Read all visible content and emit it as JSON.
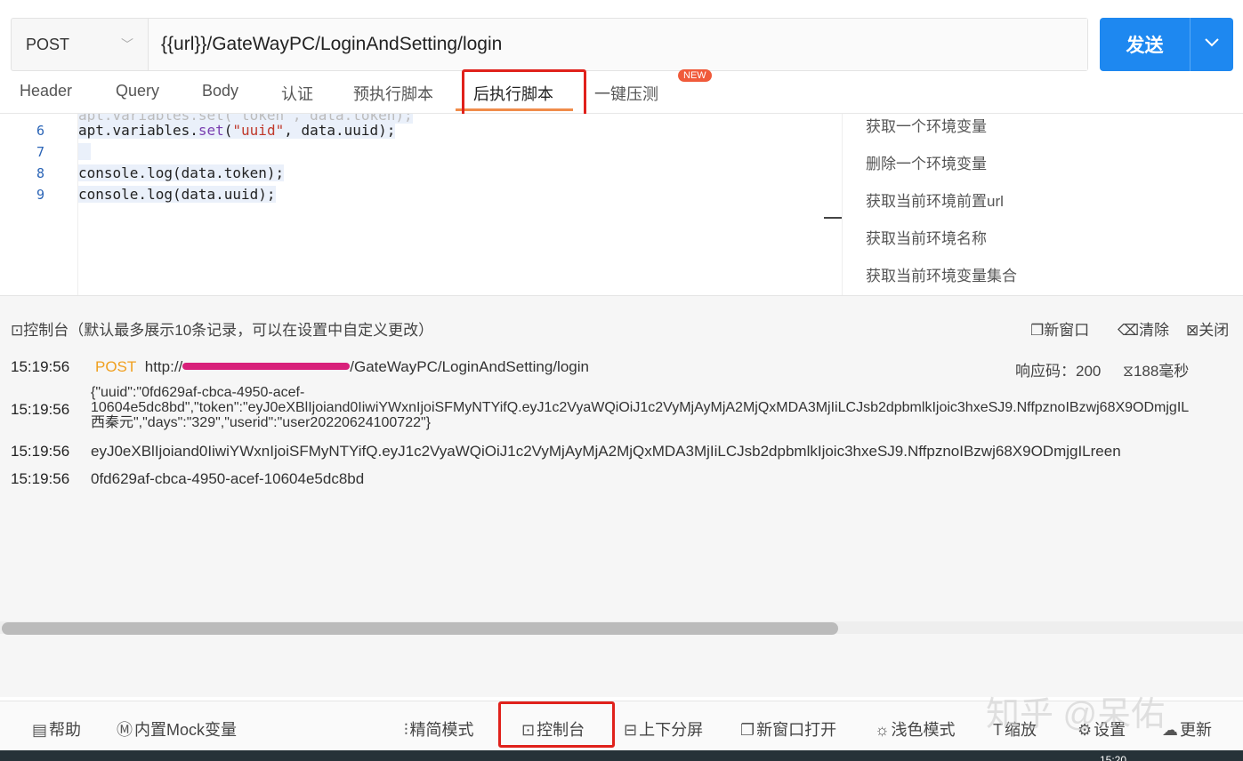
{
  "request": {
    "method": "POST",
    "url": "{{url}}/GateWayPC/LoginAndSetting/login",
    "send_label": "发送"
  },
  "tabs": [
    {
      "label": "Header"
    },
    {
      "label": "Query"
    },
    {
      "label": "Body"
    },
    {
      "label": "认证"
    },
    {
      "label": "预执行脚本"
    },
    {
      "label": "后执行脚本"
    },
    {
      "label": "一键压测"
    }
  ],
  "new_badge": "NEW",
  "editor": {
    "lines": [
      {
        "num": "6",
        "pre": "apt.variables.",
        "fn": "set",
        "mid": "(",
        "str1": "\"uuid\"",
        "post": ", data.uuid);"
      },
      {
        "num": "7",
        "text": " "
      },
      {
        "num": "8",
        "text": "console.log(data.token);"
      },
      {
        "num": "9",
        "text": "console.log(data.uuid);"
      }
    ]
  },
  "snippets": [
    "获取一个环境变量",
    "删除一个环境变量",
    "获取当前环境前置url",
    "获取当前环境名称",
    "获取当前环境变量集合"
  ],
  "console": {
    "title": "控制台（默认最多展示10条记录，可以在设置中自定义更改）",
    "actions": {
      "new_window": "新窗口",
      "clear": "清除",
      "close": "关闭"
    },
    "entries": {
      "r1_time": "15:19:56",
      "r1_method": "POST",
      "r1_url_prefix": "http://",
      "r1_url_suffix": "/GateWayPC/LoginAndSetting/login",
      "r1_status": "响应码：200",
      "r1_duration": "188毫秒",
      "r2_time": "15:19:56",
      "r2_line1": "{\"uuid\":\"0fd629af-cbca-4950-acef-",
      "r2_line2": "10604e5dc8bd\",\"token\":\"eyJ0eXBlIjoiand0IiwiYWxnIjoiSFMyNTYifQ.eyJ1c2VyaWQiOiJ1c2VyMjAyMjA2MjQxMDA3MjIiLCJsb2dpbmlkIjoic3hxeSJ9.NffpznoIBzwj68X9ODmjgIL",
      "r2_line3": "西秦元\",\"days\":\"329\",\"userid\":\"user20220624100722\"}",
      "r3_time": "15:19:56",
      "r3_text": "eyJ0eXBlIjoiand0IiwiYWxnIjoiSFMyNTYifQ.eyJ1c2VyaWQiOiJ1c2VyMjAyMjA2MjQxMDA3MjIiLCJsb2dpbmlkIjoic3hxeSJ9.NffpznoIBzwj68X9ODmjgILreen",
      "r4_time": "15:19:56",
      "r4_text": "0fd629af-cbca-4950-acef-10604e5dc8bd"
    }
  },
  "footer": {
    "help": "帮助",
    "mock": "内置Mock变量",
    "compact": "精简模式",
    "console": "控制台",
    "split": "上下分屏",
    "new_window": "新窗口打开",
    "light": "浅色模式",
    "zoom": "缩放",
    "settings": "设置",
    "update": "更新"
  },
  "taskbar_time": "15:20",
  "watermark": "知乎 @呆佑"
}
